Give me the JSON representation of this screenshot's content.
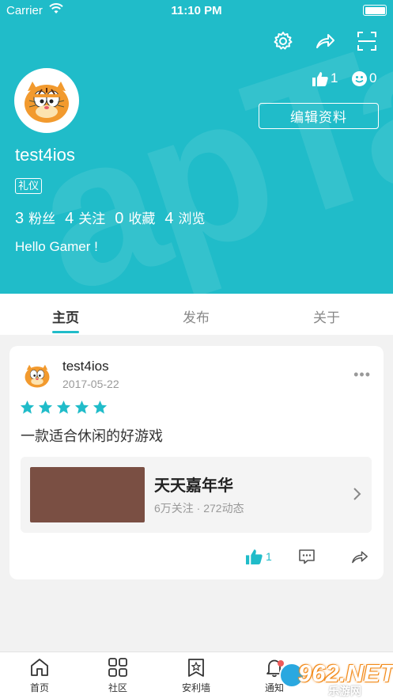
{
  "status_bar": {
    "carrier": "Carrier",
    "time": "11:10 PM"
  },
  "header": {
    "watermark": "apTap",
    "likes_count": "1",
    "smiles_count": "0",
    "edit_button": "编辑资料",
    "username": "test4ios",
    "tag": "礼仪",
    "stats": [
      {
        "num": "3",
        "label": "粉丝"
      },
      {
        "num": "4",
        "label": "关注"
      },
      {
        "num": "0",
        "label": "收藏"
      },
      {
        "num": "4",
        "label": "浏览"
      }
    ],
    "bio": "Hello Gamer !"
  },
  "tabs": [
    "主页",
    "发布",
    "关于"
  ],
  "post": {
    "user": "test4ios",
    "date": "2017-05-22",
    "rating": 5,
    "text": "一款适合休闲的好游戏",
    "game": {
      "title": "天天嘉年华",
      "meta": "6万关注 · 272动态"
    },
    "like_count": "1"
  },
  "bottom_nav": [
    {
      "label": "首页",
      "icon": "home-icon"
    },
    {
      "label": "社区",
      "icon": "grid-icon"
    },
    {
      "label": "安利墙",
      "icon": "star-badge-icon"
    },
    {
      "label": "通知",
      "icon": "bell-icon"
    }
  ],
  "brand_watermark": {
    "big": "962.NET",
    "small": "乐游网"
  },
  "colors": {
    "accent": "#20bcc9",
    "thumb": "#7a4f43"
  }
}
